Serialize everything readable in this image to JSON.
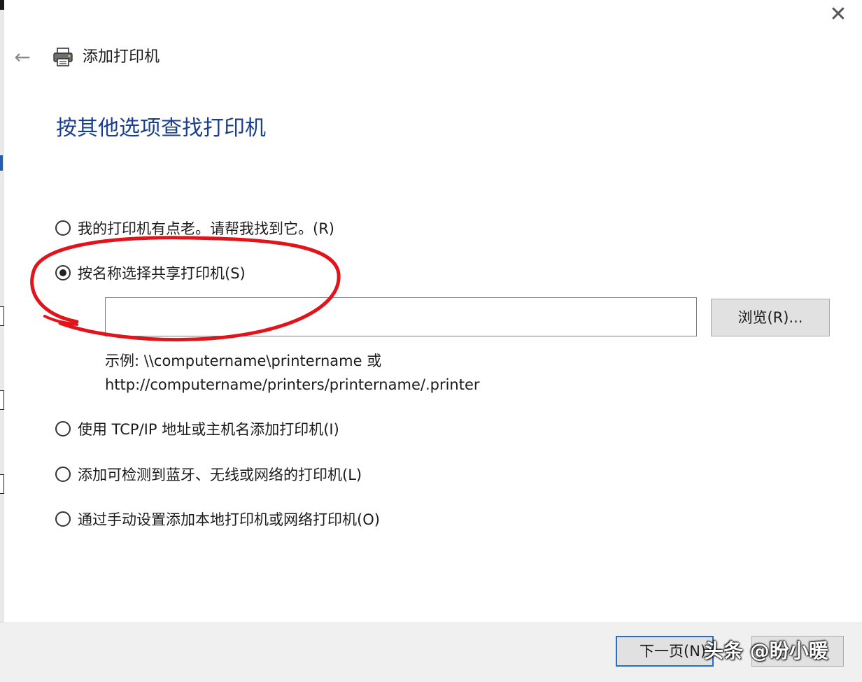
{
  "window": {
    "title": "添加打印机",
    "close_glyph": "✕",
    "back_glyph": "←"
  },
  "page": {
    "heading": "按其他选项查找打印机"
  },
  "options": [
    {
      "label": "我的打印机有点老。请帮我找到它。(R)",
      "selected": false
    },
    {
      "label": "按名称选择共享打印机(S)",
      "selected": true
    },
    {
      "label": "使用 TCP/IP 地址或主机名添加打印机(I)",
      "selected": false
    },
    {
      "label": "添加可检测到蓝牙、无线或网络的打印机(L)",
      "selected": false
    },
    {
      "label": "通过手动设置添加本地打印机或网络打印机(O)",
      "selected": false
    }
  ],
  "share": {
    "value": "",
    "browse_label": "浏览(R)...",
    "example_line1": "示例: \\\\computername\\printername 或",
    "example_line2": "http://computername/printers/printername/.printer"
  },
  "footer": {
    "next_label": "下一页(N)",
    "cancel_label": ""
  },
  "watermark": "头条 @盼小暖",
  "colors": {
    "heading": "#1a3f8f",
    "annotation_circle": "#e0141a",
    "focus_border": "#2b6cc4"
  }
}
